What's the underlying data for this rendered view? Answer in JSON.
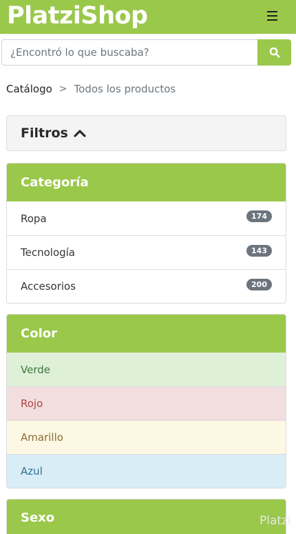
{
  "header": {
    "brand": "PlatziShop",
    "menu_icon": "hamburger-icon"
  },
  "search": {
    "placeholder": "¿Encontró lo que buscaba?",
    "value": "",
    "button_icon": "search-icon"
  },
  "breadcrumb": {
    "items": [
      "Catálogo",
      "Todos los productos"
    ],
    "separator": ">"
  },
  "filters": {
    "label": "Filtros",
    "icon": "chevron-up-icon"
  },
  "category_panel": {
    "title": "Categoría",
    "items": [
      {
        "label": "Ropa",
        "count": "174"
      },
      {
        "label": "Tecnología",
        "count": "143"
      },
      {
        "label": "Accesorios",
        "count": "200"
      }
    ]
  },
  "color_panel": {
    "title": "Color",
    "items": [
      {
        "label": "Verde",
        "bg": "#dff0d8",
        "fg": "#3c763d"
      },
      {
        "label": "Rojo",
        "bg": "#f2dede",
        "fg": "#a94442"
      },
      {
        "label": "Amarillo",
        "bg": "#fcf8e3",
        "fg": "#8a6d3b"
      },
      {
        "label": "Azul",
        "bg": "#d9edf7",
        "fg": "#31708f"
      }
    ]
  },
  "gender_panel": {
    "title": "Sexo"
  },
  "watermark": "Platzi",
  "colors": {
    "accent": "#9ac84a",
    "badge": "#6c757d"
  }
}
